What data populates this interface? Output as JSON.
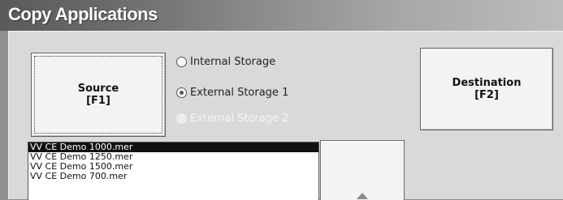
{
  "window": {
    "title": "Copy Applications"
  },
  "source_button": {
    "line1": "Source",
    "line2": "[F1]"
  },
  "destination_button": {
    "line1": "Destination",
    "line2": "[F2]"
  },
  "storage_options": [
    {
      "label": "Internal Storage",
      "checked": false,
      "enabled": true
    },
    {
      "label": "External Storage 1",
      "checked": true,
      "enabled": true
    },
    {
      "label": "External Storage 2",
      "checked": false,
      "enabled": false
    }
  ],
  "file_list": {
    "items": [
      "VV CE Demo 1000.mer",
      "VV CE Demo 1250.mer",
      "VV CE Demo 1500.mer",
      "VV CE Demo 700.mer"
    ],
    "selected_index": 0
  },
  "icons": {
    "scroll_up": "triangle-up-icon"
  }
}
